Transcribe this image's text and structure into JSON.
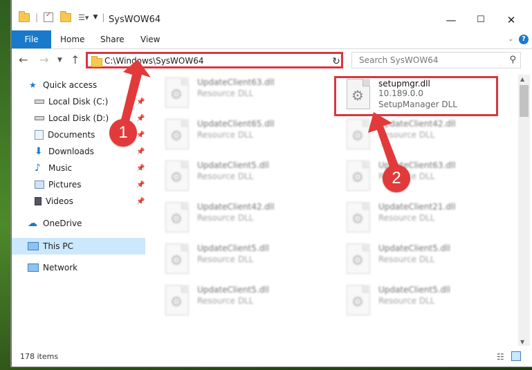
{
  "window": {
    "title": "SysWOW64",
    "controls": {
      "minimize": "—",
      "maximize": "☐",
      "close": "✕"
    }
  },
  "ribbon": {
    "file": "File",
    "tabs": [
      "Home",
      "Share",
      "View"
    ]
  },
  "navigation": {
    "address": "C:\\Windows\\SysWOW64",
    "search_placeholder": "Search SysWOW64"
  },
  "sidebar": {
    "items": [
      {
        "label": "Quick access",
        "icon": "star-icon"
      },
      {
        "label": "Local Disk (C:)",
        "icon": "drive-icon",
        "pinned": true
      },
      {
        "label": "Local Disk (D:)",
        "icon": "drive-icon",
        "pinned": true
      },
      {
        "label": "Documents",
        "icon": "documents-icon",
        "pinned": true
      },
      {
        "label": "Downloads",
        "icon": "download-icon",
        "pinned": true
      },
      {
        "label": "Music",
        "icon": "music-icon",
        "pinned": true
      },
      {
        "label": "Pictures",
        "icon": "pictures-icon",
        "pinned": true
      },
      {
        "label": "Videos",
        "icon": "videos-icon",
        "pinned": true
      },
      {
        "label": "OneDrive",
        "icon": "cloud-icon"
      },
      {
        "label": "This PC",
        "icon": "computer-icon",
        "selected": true
      },
      {
        "label": "Network",
        "icon": "network-icon"
      }
    ]
  },
  "files": {
    "left": [
      {
        "name": "UpdateClient63.dll",
        "type": "Resource DLL"
      },
      {
        "name": "UpdateClient65.dll",
        "type": "Resource DLL"
      },
      {
        "name": "UpdateClient5.dll",
        "type": "Resource DLL"
      },
      {
        "name": "UpdateClient42.dll",
        "type": "Resource DLL"
      },
      {
        "name": "UpdateClient5.dll",
        "type": "Resource DLL"
      },
      {
        "name": "UpdateClient5.dll",
        "type": "Resource DLL"
      }
    ],
    "right": [
      {
        "name": "setupmgr.dll",
        "version": "10.189.0.0",
        "type": "SetupManager DLL",
        "highlighted": true
      },
      {
        "name": "UpdateClient42.dll",
        "type": "Resource DLL"
      },
      {
        "name": "UpdateClient63.dll",
        "type": "Resource DLL"
      },
      {
        "name": "UpdateClient21.dll",
        "type": "Resource DLL"
      },
      {
        "name": "UpdateClient5.dll",
        "type": "Resource DLL"
      },
      {
        "name": "UpdateClient5.dll",
        "type": "Resource DLL"
      }
    ]
  },
  "status": {
    "item_count": "178 items"
  },
  "annotations": {
    "marker1": "1",
    "marker2": "2"
  },
  "colors": {
    "accent": "#1979ca",
    "annotation_red": "#d9363e",
    "selection": "#cce8ff"
  }
}
